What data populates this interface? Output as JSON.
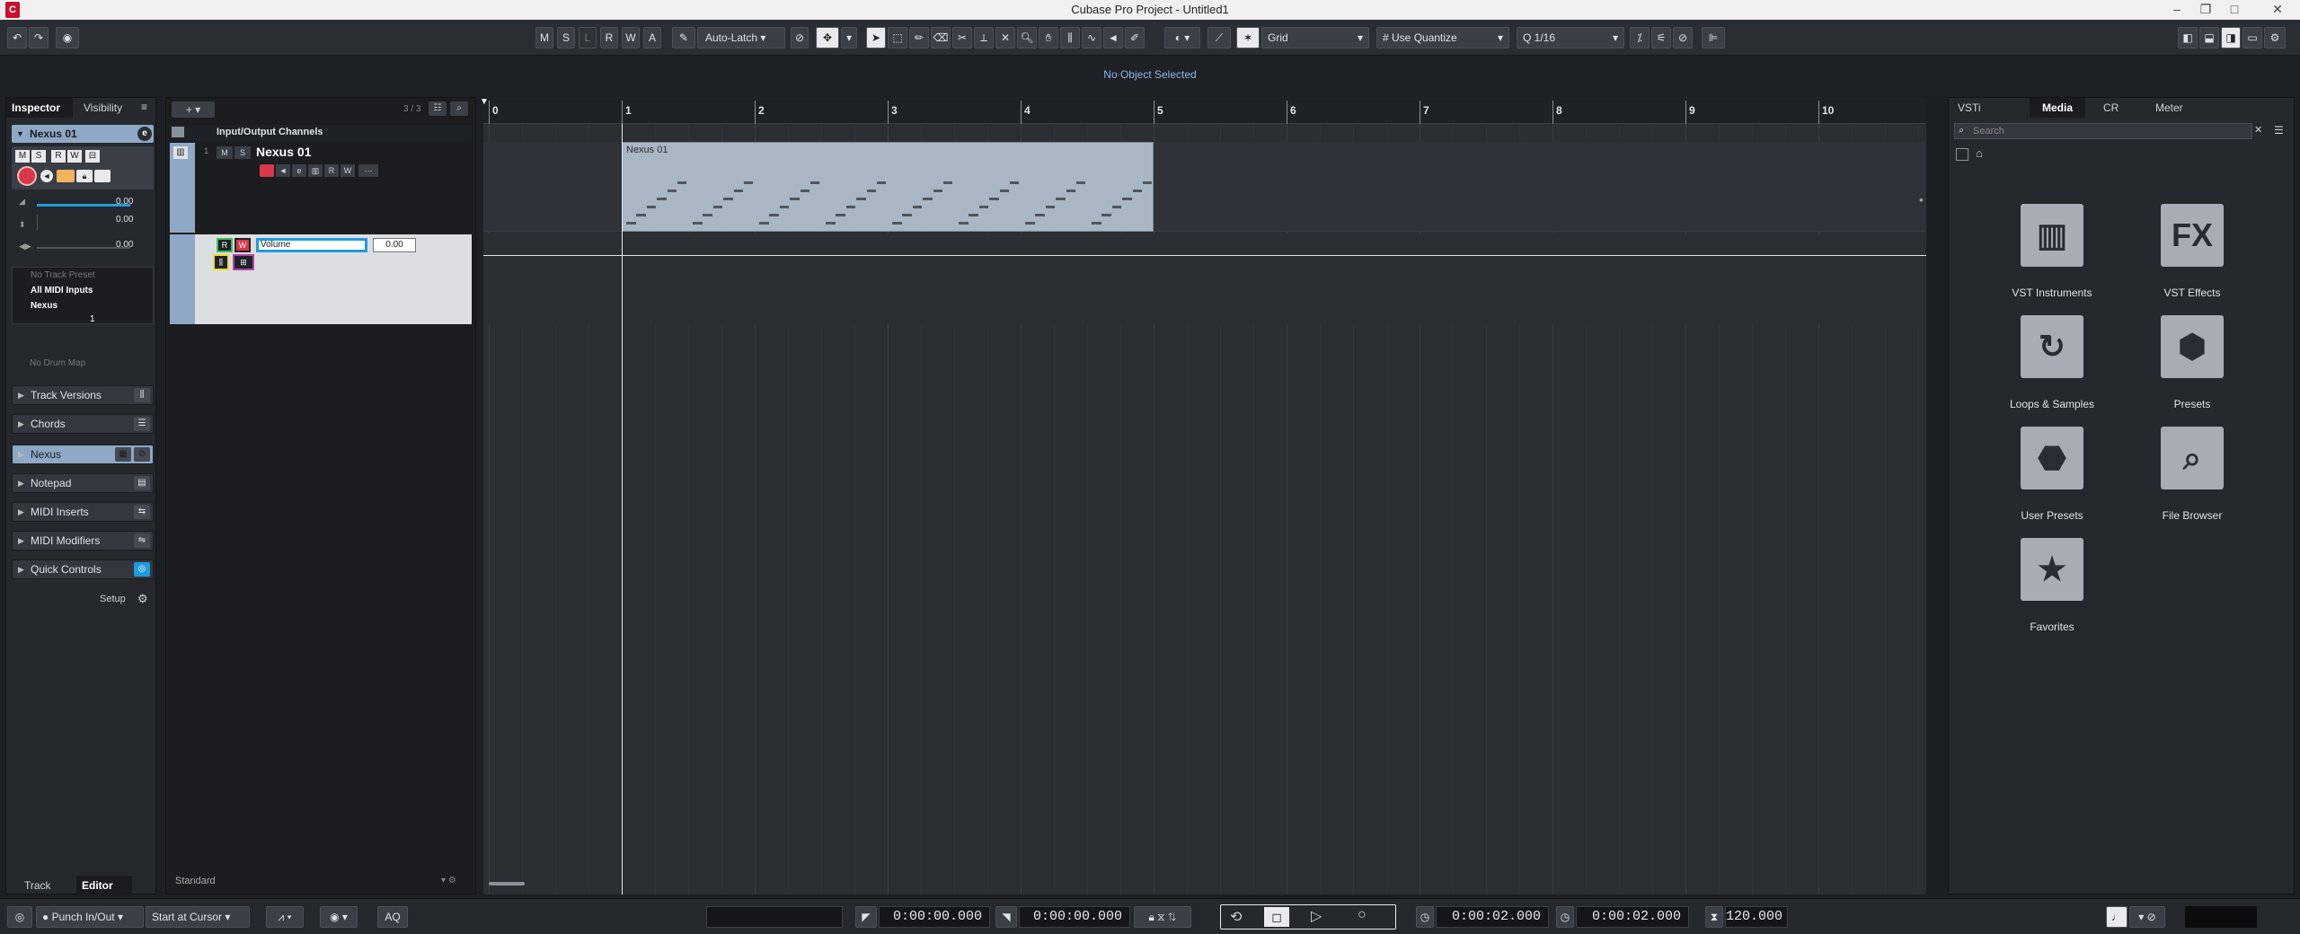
{
  "window": {
    "title": "Cubase Pro Project - Untitled1",
    "logo": "C"
  },
  "toolbar": {
    "ms_buttons": [
      "M",
      "S",
      "L",
      "R",
      "W",
      "A"
    ],
    "automation_mode": "Auto-Latch",
    "snap_type": "Grid",
    "quantize_mode": "Use Quantize",
    "quantize_value": "1/16"
  },
  "infoline": {
    "message": "No Object Selected"
  },
  "inspector": {
    "tabs": [
      "Inspector",
      "Visibility"
    ],
    "track_name": "Nexus 01",
    "volume": "0.00",
    "pan": "0.00",
    "delay": "0.00",
    "preset": "No Track Preset",
    "input": "All MIDI Inputs",
    "output": "Nexus",
    "channel": "1",
    "drum_map": "No Drum Map",
    "sections": [
      "Track Versions",
      "Chords",
      "Nexus",
      "Notepad",
      "MIDI Inserts",
      "MIDI Modifiers",
      "Quick Controls"
    ],
    "setup_label": "Setup",
    "bottom_tabs": [
      "Track",
      "Editor"
    ]
  },
  "tracklist": {
    "count": "3 / 3",
    "folder_name": "Input/Output Channels",
    "track_name": "Nexus 01",
    "track_number": "1",
    "automation_param": "Volume",
    "automation_value": "0.00",
    "footer": "Standard"
  },
  "arrange": {
    "bars": [
      "0",
      "1",
      "2",
      "3",
      "4",
      "5",
      "6",
      "7",
      "8",
      "9",
      "10"
    ],
    "part_name": "Nexus 01"
  },
  "media": {
    "tabs": [
      "VSTi",
      "Media",
      "CR",
      "Meter"
    ],
    "search_placeholder": "Search",
    "tiles": [
      {
        "label": "VST Instruments",
        "icon": "piano-icon"
      },
      {
        "label": "VST Effects",
        "icon": "fx-icon"
      },
      {
        "label": "Loops & Samples",
        "icon": "loop-icon"
      },
      {
        "label": "Presets",
        "icon": "hexagons-icon"
      },
      {
        "label": "User Presets",
        "icon": "user-preset-icon"
      },
      {
        "label": "File Browser",
        "icon": "file-browser-icon"
      },
      {
        "label": "Favorites",
        "icon": "star-icon"
      }
    ]
  },
  "status": {
    "punch": "Punch In/Out",
    "start_mode": "Start at Cursor",
    "aq": "AQ",
    "left_locator": "0:00:00.000",
    "right_locator": "0:00:00.000",
    "position_primary": "0:00:02.000",
    "position_secondary": "0:00:02.000",
    "tempo": "120.000"
  },
  "colors": {
    "accent": "#1f9bde",
    "record": "#d9384a",
    "part": "#a9b6c4",
    "track_bg": "#dcdee2"
  }
}
